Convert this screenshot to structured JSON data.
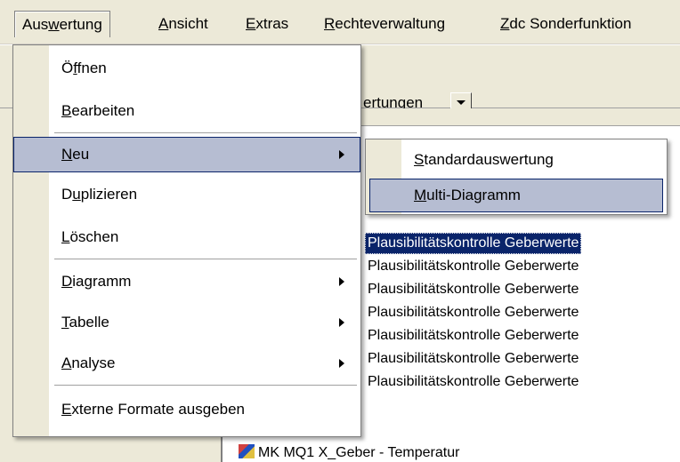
{
  "menubar": [
    {
      "pre": "Aus",
      "key": "w",
      "post": "ertung"
    },
    {
      "pre": "",
      "key": "A",
      "post": "nsicht"
    },
    {
      "pre": "",
      "key": "E",
      "post": "xtras"
    },
    {
      "pre": "",
      "key": "R",
      "post": "echteverwaltung"
    },
    {
      "pre": "",
      "key": "Z",
      "post": "dc Sonderfunktion"
    }
  ],
  "toolbar": {
    "label": "ertungen"
  },
  "menu": {
    "items": [
      {
        "pre": "Ö",
        "key": "f",
        "post": "fnen"
      },
      {
        "pre": "",
        "key": "B",
        "post": "earbeiten"
      },
      {
        "pre": "",
        "key": "N",
        "post": "eu"
      },
      {
        "pre": "D",
        "key": "u",
        "post": "plizieren"
      },
      {
        "pre": "",
        "key": "L",
        "post": "öschen"
      },
      {
        "pre": "",
        "key": "D",
        "post": "iagramm"
      },
      {
        "pre": "",
        "key": "T",
        "post": "abelle"
      },
      {
        "pre": "",
        "key": "A",
        "post": "nalyse"
      },
      {
        "pre": "",
        "key": "E",
        "post": "xterne Formate ausgeben"
      }
    ]
  },
  "submenu": {
    "items": [
      {
        "pre": "",
        "key": "S",
        "post": "tandardauswertung"
      },
      {
        "pre": "",
        "key": "M",
        "post": "ulti-Diagramm"
      }
    ]
  },
  "tree": {
    "rows": [
      "Plausibilitätskontrolle Geberwerte",
      "Plausibilitätskontrolle Geberwerte",
      "Plausibilitätskontrolle Geberwerte",
      "Plausibilitätskontrolle Geberwerte",
      "Plausibilitätskontrolle Geberwerte",
      "Plausibilitätskontrolle Geberwerte",
      "Plausibilitätskontrolle Geberwerte"
    ],
    "cut_prefix": "MK MQ1",
    "partial": "MK MQ1 X_Geber - Temperatur"
  }
}
